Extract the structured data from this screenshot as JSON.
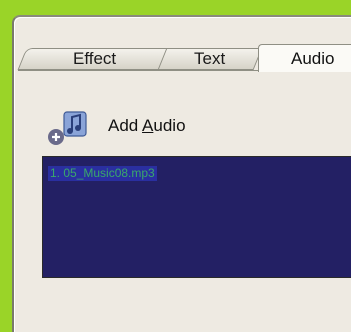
{
  "tabs": [
    {
      "label": "Effect",
      "active": false
    },
    {
      "label": "Text",
      "active": false
    },
    {
      "label": "Audio",
      "active": true
    }
  ],
  "add_audio": {
    "label_prefix": "Add ",
    "label_accel": "A",
    "label_rest": "udio",
    "icon": "add-audio-icon"
  },
  "audio_list": {
    "items": [
      "1. 05_Music08.mp3"
    ]
  },
  "colors": {
    "background": "#9ad428",
    "panel": "#eeeae2",
    "list_background": "#232064",
    "item_text": "#3aa86a"
  }
}
